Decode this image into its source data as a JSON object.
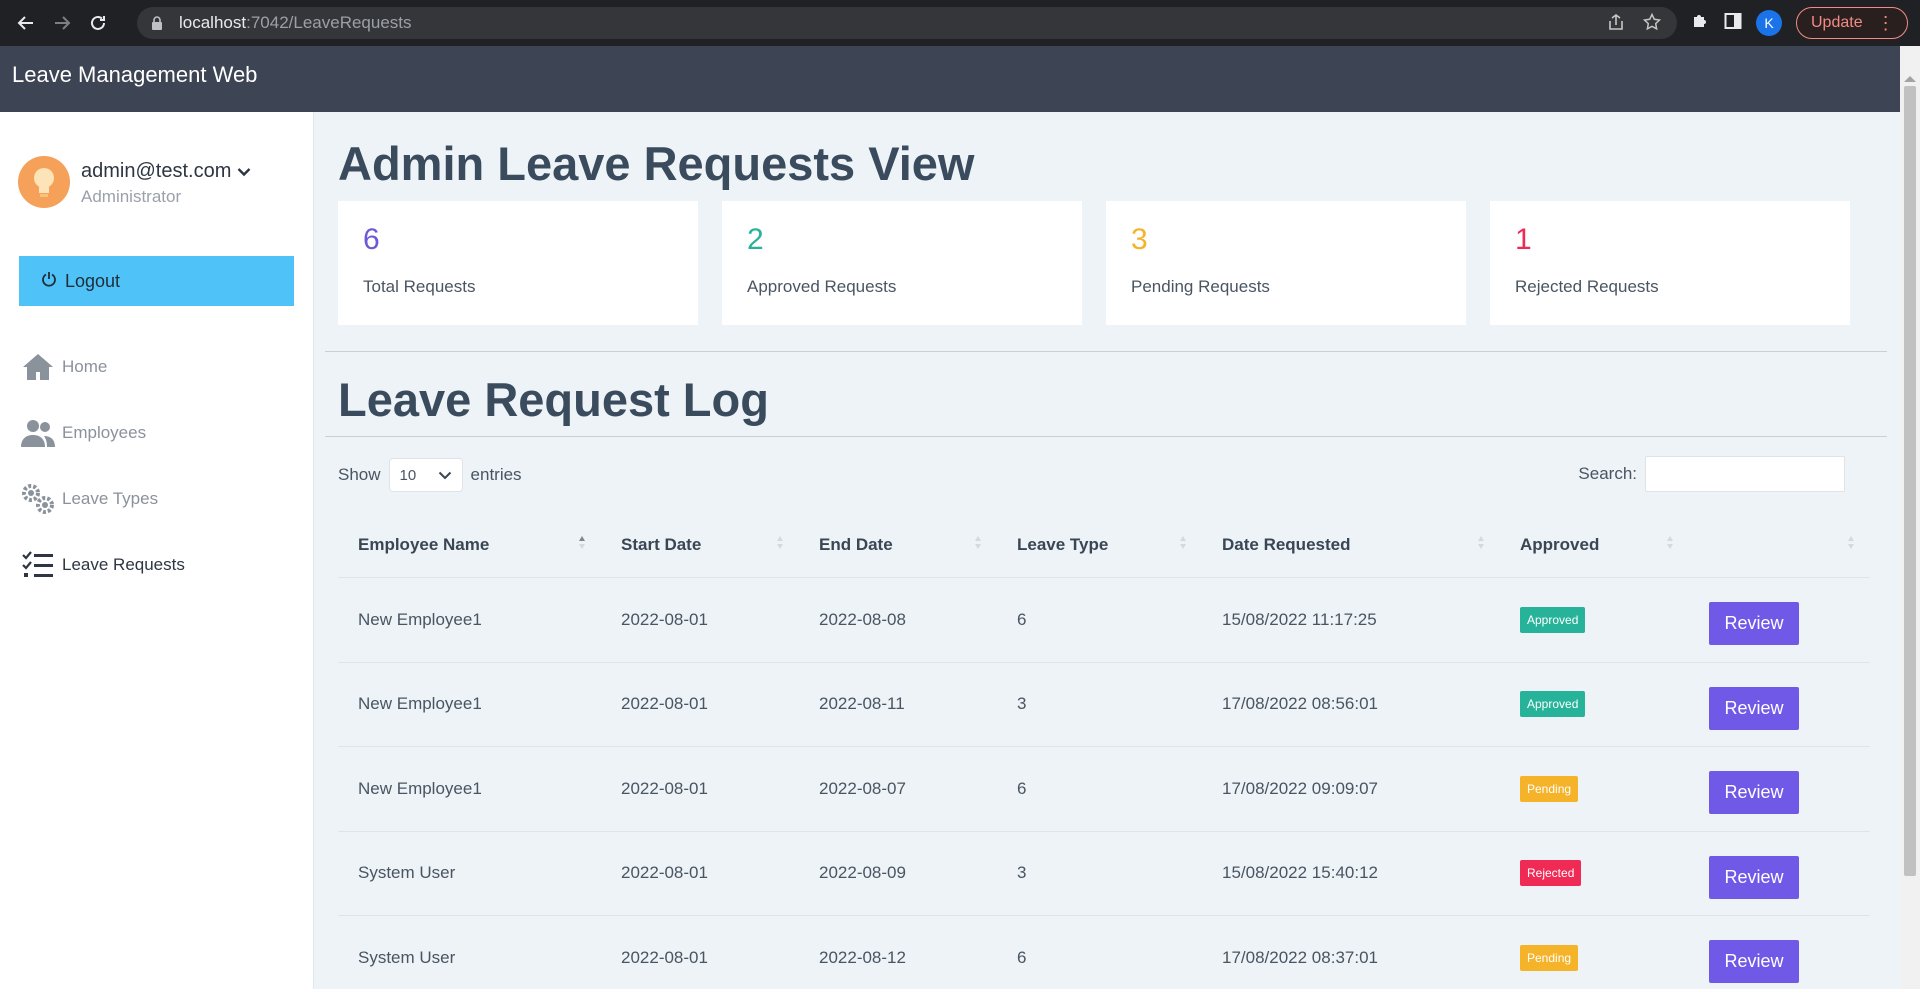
{
  "browser": {
    "url_host": "localhost",
    "url_path": ":7042/LeaveRequests",
    "profile_initial": "K",
    "update_label": "Update"
  },
  "app": {
    "brand": "Leave Management Web"
  },
  "user": {
    "email": "admin@test.com",
    "role": "Administrator"
  },
  "sidebar": {
    "logout_label": "Logout",
    "items": [
      {
        "label": "Home",
        "icon": "home-icon"
      },
      {
        "label": "Employees",
        "icon": "users-icon"
      },
      {
        "label": "Leave Types",
        "icon": "gears-icon"
      },
      {
        "label": "Leave Requests",
        "icon": "checklist-icon"
      }
    ]
  },
  "page": {
    "title": "Admin Leave Requests View",
    "log_title": "Leave Request Log"
  },
  "stats": [
    {
      "value": "6",
      "label": "Total Requests",
      "color": "#6f58d8"
    },
    {
      "value": "2",
      "label": "Approved Requests",
      "color": "#26b39a"
    },
    {
      "value": "3",
      "label": "Pending Requests",
      "color": "#f5b32a"
    },
    {
      "value": "1",
      "label": "Rejected Requests",
      "color": "#ee2a55"
    }
  ],
  "table_controls": {
    "show_label": "Show",
    "entries_value": "10",
    "entries_label": "entries",
    "search_label": "Search:"
  },
  "table": {
    "columns": [
      "Employee Name",
      "Start Date",
      "End Date",
      "Leave Type",
      "Date Requested",
      "Approved",
      ""
    ],
    "review_label": "Review",
    "status_colors": {
      "Approved": "#26b39a",
      "Pending": "#f5b32a",
      "Rejected": "#ee2a55"
    },
    "rows": [
      {
        "employee": "New Employee1",
        "start": "2022-08-01",
        "end": "2022-08-08",
        "type": "6",
        "requested": "15/08/2022 11:17:25",
        "status": "Approved"
      },
      {
        "employee": "New Employee1",
        "start": "2022-08-01",
        "end": "2022-08-11",
        "type": "3",
        "requested": "17/08/2022 08:56:01",
        "status": "Approved"
      },
      {
        "employee": "New Employee1",
        "start": "2022-08-01",
        "end": "2022-08-07",
        "type": "6",
        "requested": "17/08/2022 09:09:07",
        "status": "Pending"
      },
      {
        "employee": "System User",
        "start": "2022-08-01",
        "end": "2022-08-09",
        "type": "3",
        "requested": "15/08/2022 15:40:12",
        "status": "Rejected"
      },
      {
        "employee": "System User",
        "start": "2022-08-01",
        "end": "2022-08-12",
        "type": "6",
        "requested": "17/08/2022 08:37:01",
        "status": "Pending"
      }
    ]
  }
}
